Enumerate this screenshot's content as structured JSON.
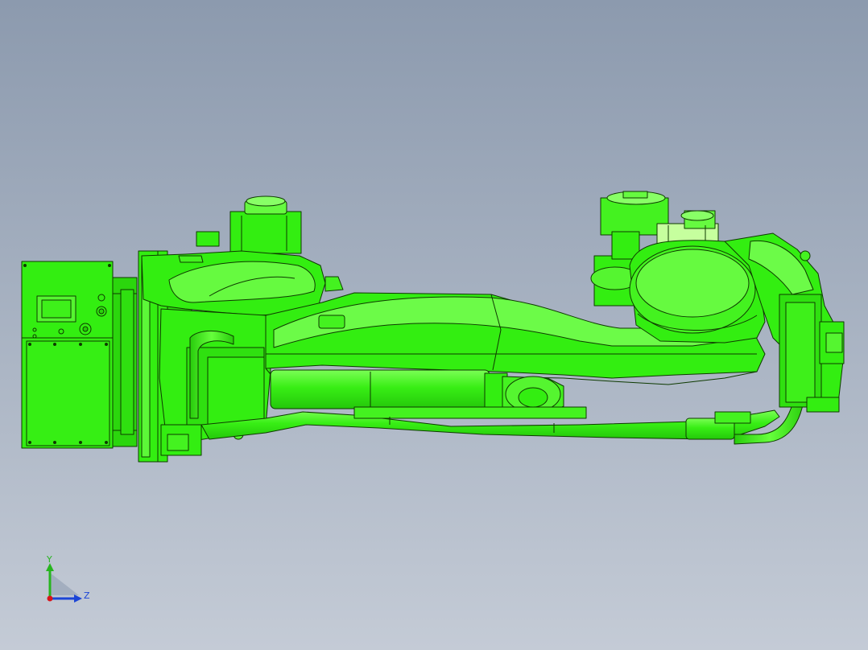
{
  "colors": {
    "background_top": "#8c9aae",
    "background_bottom": "#c4cbd6",
    "model_fill": "#33ee11",
    "model_fill_light": "#8cff6a",
    "model_fill_pale": "#c6ff9e",
    "model_fill_dark": "#22c409",
    "edge": "#0e3a00",
    "axis_x": "#d9141a",
    "axis_y": "#27b51f",
    "axis_z": "#1b45d6"
  },
  "viewport": {
    "model_name_icon": "robot-arm-3d-model",
    "axis_triad": {
      "y_label": "Y",
      "z_label": "Z"
    }
  }
}
